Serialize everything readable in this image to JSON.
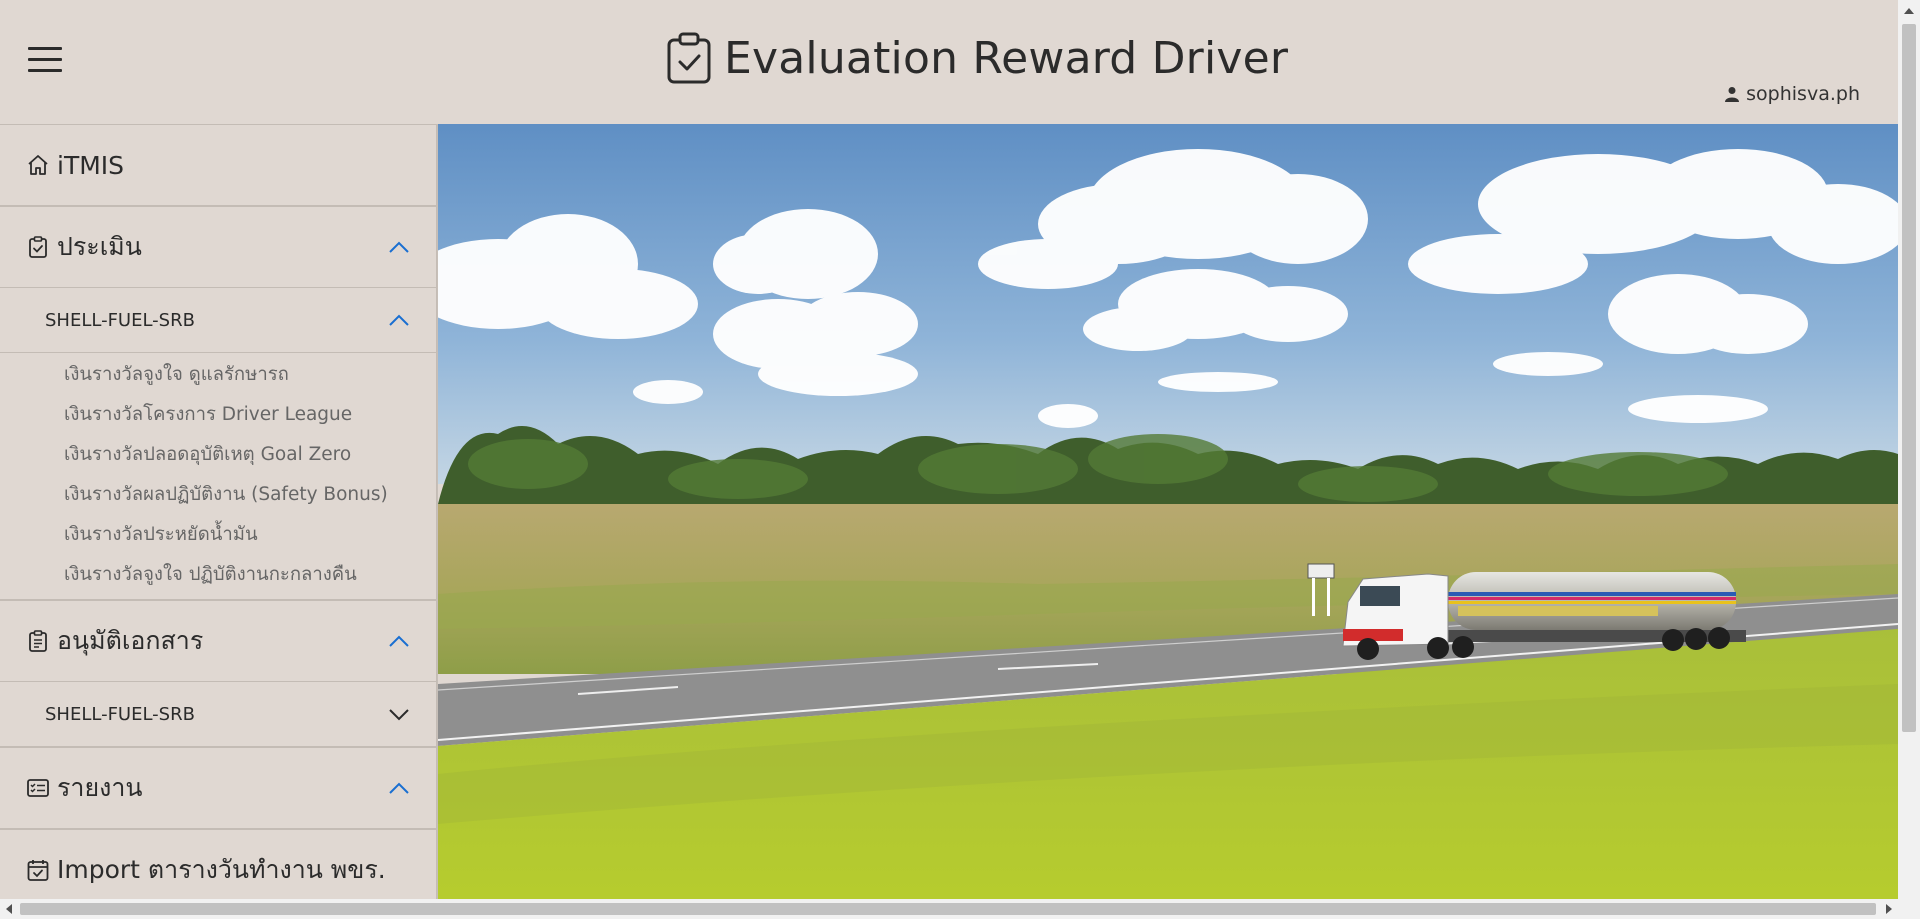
{
  "header": {
    "title": "Evaluation Reward Driver",
    "username": "sophisva.ph"
  },
  "sidebar": {
    "home": {
      "label": "iTMIS",
      "icon": "home-icon"
    },
    "evaluate": {
      "label": "ประเมิน",
      "icon": "clipboard-check-icon",
      "expanded": true,
      "group": {
        "label": "SHELL-FUEL-SRB",
        "expanded": true,
        "items": [
          "เงินรางวัลจูงใจ ดูแลรักษารถ",
          "เงินรางวัลโครงการ Driver League",
          "เงินรางวัลปลอดอุบัติเหตุ Goal Zero",
          "เงินรางวัลผลปฏิบัติงาน (Safety Bonus)",
          "เงินรางวัลประหยัดน้ำมัน",
          "เงินรางวัลจูงใจ ปฏิบัติงานกะกลางคืน"
        ]
      }
    },
    "approve": {
      "label": "อนุมัติเอกสาร",
      "icon": "clipboard-document-icon",
      "expanded": true,
      "group": {
        "label": "SHELL-FUEL-SRB",
        "expanded": false
      }
    },
    "report": {
      "label": "รายงาน",
      "icon": "list-card-icon",
      "expanded": true
    },
    "import": {
      "label": "Import ตารางวันทำงาน พขร.",
      "icon": "calendar-check-icon"
    }
  },
  "hero": {
    "icon": "hero-image-fuel-tanker-truck"
  },
  "colors": {
    "background": "#e0d8d2",
    "accent_chevron": "#1a6fd1",
    "text": "#2b2b2b",
    "muted_text": "#666666"
  }
}
